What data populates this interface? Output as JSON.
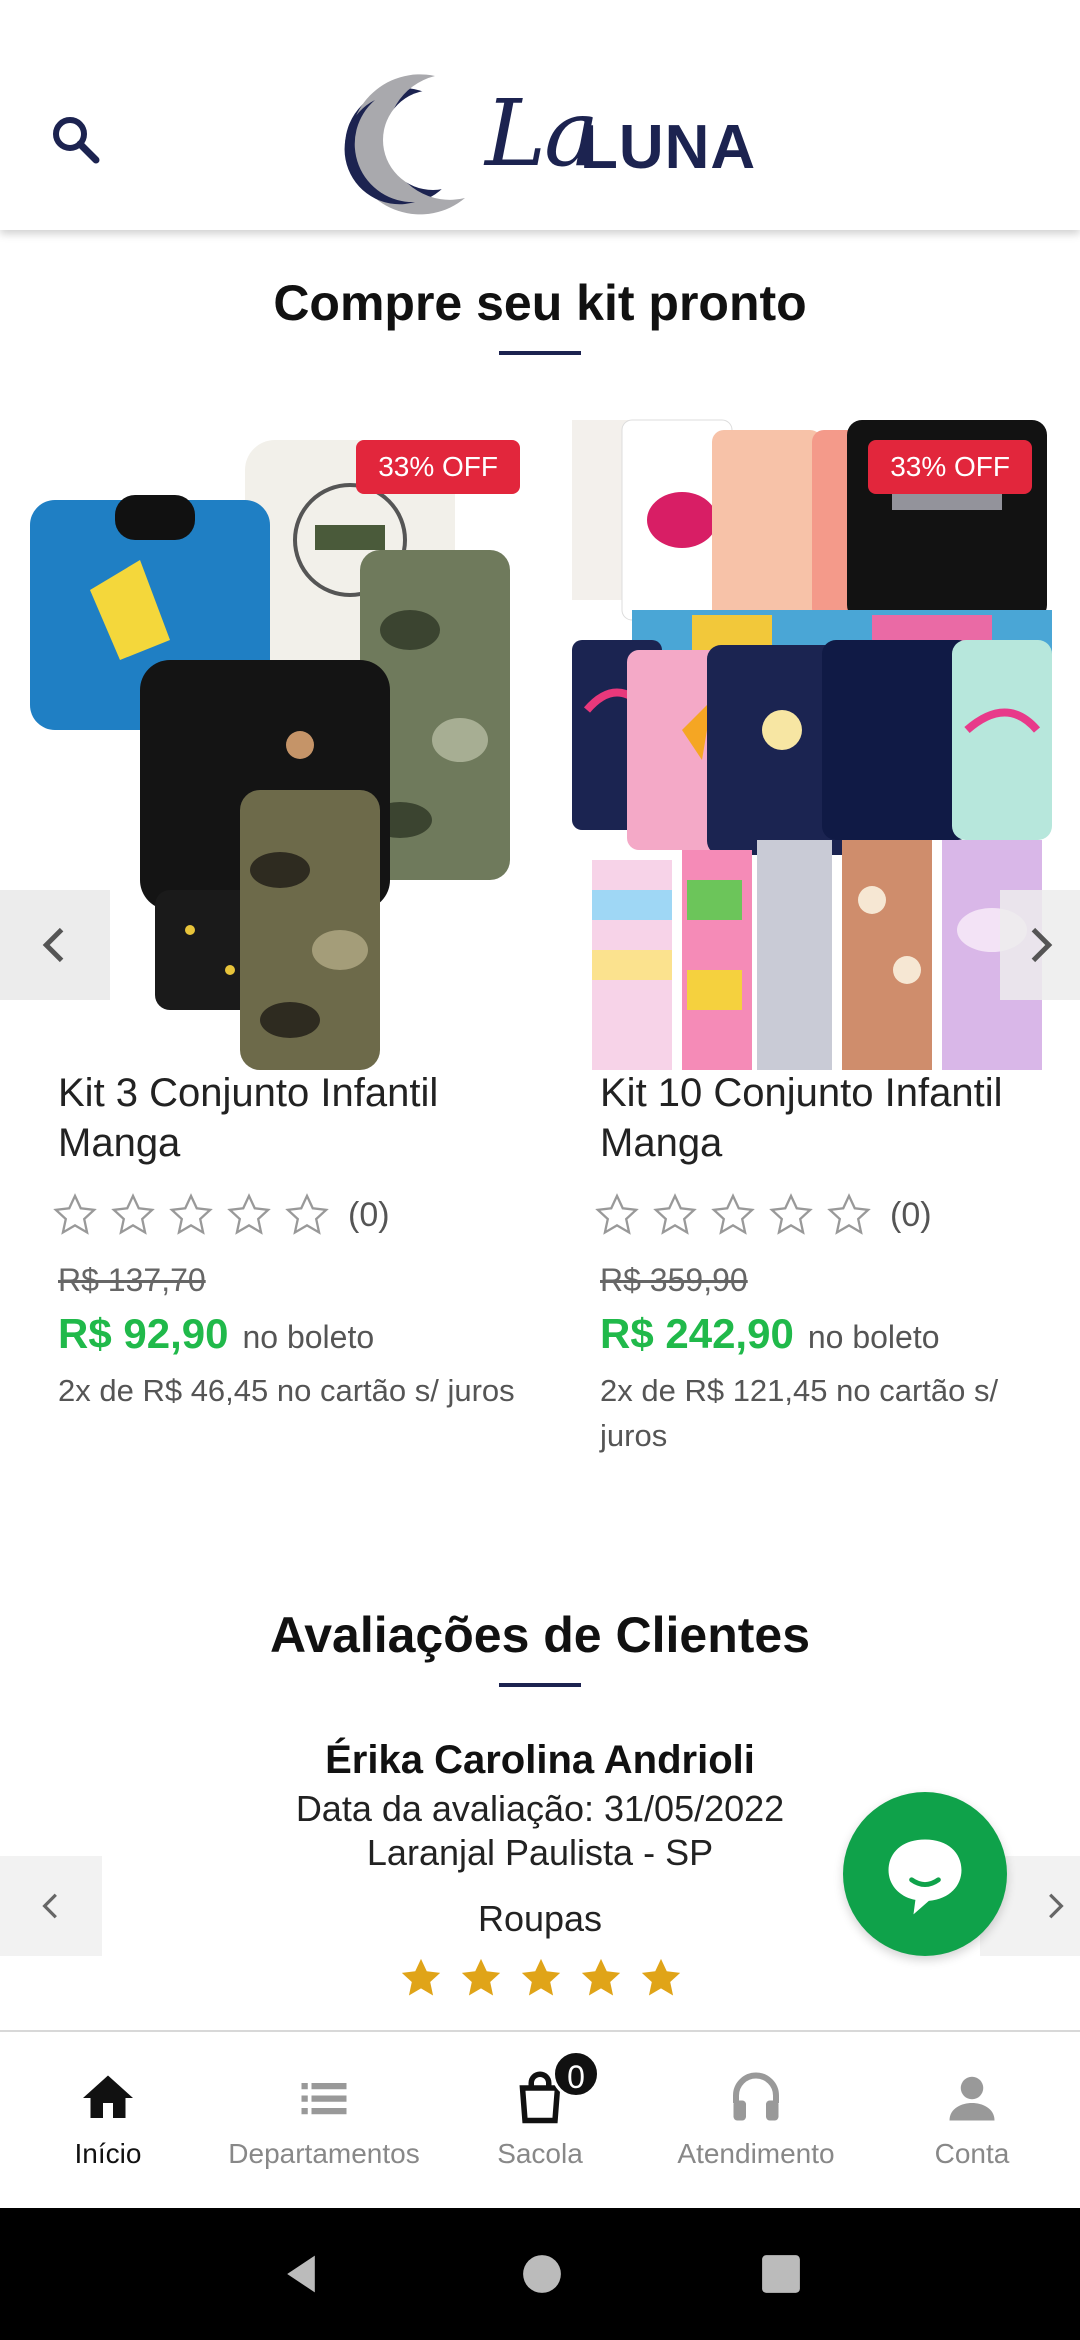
{
  "header": {
    "logo_la": "La",
    "logo_luna": "LUNA"
  },
  "kits_section": {
    "title": "Compre seu kit pronto"
  },
  "products": [
    {
      "badge": "33% OFF",
      "name": "Kit 3 Conjunto Infantil Manga",
      "rating_count": "(0)",
      "rating": 0,
      "old_price": "R$ 137,70",
      "price": "R$ 92,90",
      "price_suffix": "no boleto",
      "installments": "2x de R$ 46,45 no cartão s/ juros"
    },
    {
      "badge": "33% OFF",
      "name": "Kit 10 Conjunto Infantil Manga",
      "rating_count": "(0)",
      "rating": 0,
      "old_price": "R$ 359,90",
      "price": "R$ 242,90",
      "price_suffix": "no boleto",
      "installments": "2x de R$ 121,45 no cartão s/ juros"
    }
  ],
  "reviews_section": {
    "title": "Avaliações de Clientes",
    "reviewer": "Érika Carolina Andrioli",
    "date_line": "Data da avaliação: 31/05/2022",
    "location": "Laranjal Paulista - SP",
    "category": "Roupas",
    "rating": 5
  },
  "nav": {
    "items": [
      {
        "label": "Início",
        "icon": "home-icon",
        "active": true
      },
      {
        "label": "Departamentos",
        "icon": "list-icon",
        "active": false
      },
      {
        "label": "Sacola",
        "icon": "shopping-bag-icon",
        "active": false
      },
      {
        "label": "Atendimento",
        "icon": "headset-icon",
        "active": false
      },
      {
        "label": "Conta",
        "icon": "person-icon",
        "active": false
      }
    ],
    "cart_count": "0"
  },
  "colors": {
    "brand_navy": "#1c2350",
    "price_green": "#20b94a",
    "badge_red": "#e2263c",
    "chat_green": "#0fa24a",
    "star_gold": "#e0a418"
  }
}
